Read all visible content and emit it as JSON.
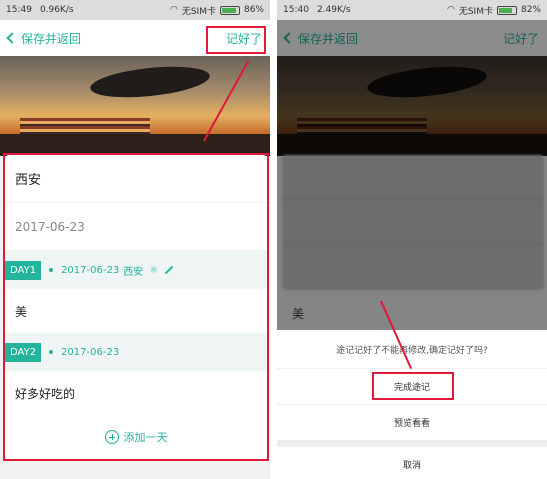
{
  "left": {
    "status": {
      "time": "15:49",
      "speed": "0.96K/s",
      "carrier": "无SIM卡",
      "battery": "86%"
    },
    "title": {
      "back_label": "保存并返回",
      "done_label": "记好了"
    },
    "form": {
      "city": "西安",
      "date": "2017-06-23",
      "days": [
        {
          "tag": "DAY1",
          "date": "2017-06-23",
          "place": "西安"
        },
        {
          "tag": "DAY2",
          "date": "2017-06-23"
        }
      ],
      "day1_note": "美",
      "day2_note": "好多好吃的",
      "add_day": "添加一天"
    }
  },
  "right": {
    "status": {
      "time": "15:40",
      "speed": "2.49K/s",
      "carrier": "无SIM卡",
      "battery": "82%"
    },
    "title": {
      "back_label": "保存并返回",
      "done_label": "记好了"
    },
    "note": "美",
    "dialog": {
      "message": "途记记好了不能再修改,确定记好了吗?",
      "confirm": "完成途记",
      "preview": "预览看看",
      "cancel": "取消"
    }
  },
  "colors": {
    "accent": "#24b39b",
    "highlight": "#e0183a"
  }
}
